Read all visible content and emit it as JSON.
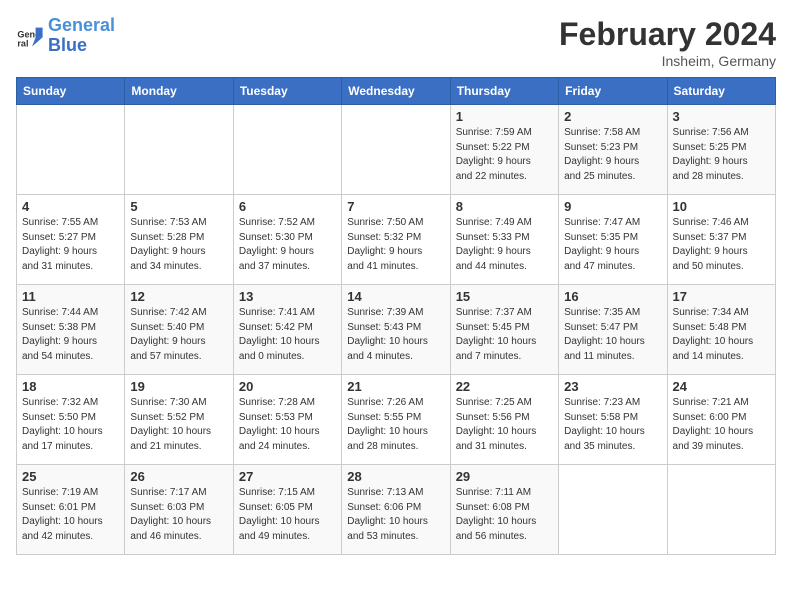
{
  "logo": {
    "line1": "General",
    "line2": "Blue"
  },
  "header": {
    "month": "February 2024",
    "location": "Insheim, Germany"
  },
  "weekdays": [
    "Sunday",
    "Monday",
    "Tuesday",
    "Wednesday",
    "Thursday",
    "Friday",
    "Saturday"
  ],
  "weeks": [
    [
      {
        "day": "",
        "info": ""
      },
      {
        "day": "",
        "info": ""
      },
      {
        "day": "",
        "info": ""
      },
      {
        "day": "",
        "info": ""
      },
      {
        "day": "1",
        "info": "Sunrise: 7:59 AM\nSunset: 5:22 PM\nDaylight: 9 hours\nand 22 minutes."
      },
      {
        "day": "2",
        "info": "Sunrise: 7:58 AM\nSunset: 5:23 PM\nDaylight: 9 hours\nand 25 minutes."
      },
      {
        "day": "3",
        "info": "Sunrise: 7:56 AM\nSunset: 5:25 PM\nDaylight: 9 hours\nand 28 minutes."
      }
    ],
    [
      {
        "day": "4",
        "info": "Sunrise: 7:55 AM\nSunset: 5:27 PM\nDaylight: 9 hours\nand 31 minutes."
      },
      {
        "day": "5",
        "info": "Sunrise: 7:53 AM\nSunset: 5:28 PM\nDaylight: 9 hours\nand 34 minutes."
      },
      {
        "day": "6",
        "info": "Sunrise: 7:52 AM\nSunset: 5:30 PM\nDaylight: 9 hours\nand 37 minutes."
      },
      {
        "day": "7",
        "info": "Sunrise: 7:50 AM\nSunset: 5:32 PM\nDaylight: 9 hours\nand 41 minutes."
      },
      {
        "day": "8",
        "info": "Sunrise: 7:49 AM\nSunset: 5:33 PM\nDaylight: 9 hours\nand 44 minutes."
      },
      {
        "day": "9",
        "info": "Sunrise: 7:47 AM\nSunset: 5:35 PM\nDaylight: 9 hours\nand 47 minutes."
      },
      {
        "day": "10",
        "info": "Sunrise: 7:46 AM\nSunset: 5:37 PM\nDaylight: 9 hours\nand 50 minutes."
      }
    ],
    [
      {
        "day": "11",
        "info": "Sunrise: 7:44 AM\nSunset: 5:38 PM\nDaylight: 9 hours\nand 54 minutes."
      },
      {
        "day": "12",
        "info": "Sunrise: 7:42 AM\nSunset: 5:40 PM\nDaylight: 9 hours\nand 57 minutes."
      },
      {
        "day": "13",
        "info": "Sunrise: 7:41 AM\nSunset: 5:42 PM\nDaylight: 10 hours\nand 0 minutes."
      },
      {
        "day": "14",
        "info": "Sunrise: 7:39 AM\nSunset: 5:43 PM\nDaylight: 10 hours\nand 4 minutes."
      },
      {
        "day": "15",
        "info": "Sunrise: 7:37 AM\nSunset: 5:45 PM\nDaylight: 10 hours\nand 7 minutes."
      },
      {
        "day": "16",
        "info": "Sunrise: 7:35 AM\nSunset: 5:47 PM\nDaylight: 10 hours\nand 11 minutes."
      },
      {
        "day": "17",
        "info": "Sunrise: 7:34 AM\nSunset: 5:48 PM\nDaylight: 10 hours\nand 14 minutes."
      }
    ],
    [
      {
        "day": "18",
        "info": "Sunrise: 7:32 AM\nSunset: 5:50 PM\nDaylight: 10 hours\nand 17 minutes."
      },
      {
        "day": "19",
        "info": "Sunrise: 7:30 AM\nSunset: 5:52 PM\nDaylight: 10 hours\nand 21 minutes."
      },
      {
        "day": "20",
        "info": "Sunrise: 7:28 AM\nSunset: 5:53 PM\nDaylight: 10 hours\nand 24 minutes."
      },
      {
        "day": "21",
        "info": "Sunrise: 7:26 AM\nSunset: 5:55 PM\nDaylight: 10 hours\nand 28 minutes."
      },
      {
        "day": "22",
        "info": "Sunrise: 7:25 AM\nSunset: 5:56 PM\nDaylight: 10 hours\nand 31 minutes."
      },
      {
        "day": "23",
        "info": "Sunrise: 7:23 AM\nSunset: 5:58 PM\nDaylight: 10 hours\nand 35 minutes."
      },
      {
        "day": "24",
        "info": "Sunrise: 7:21 AM\nSunset: 6:00 PM\nDaylight: 10 hours\nand 39 minutes."
      }
    ],
    [
      {
        "day": "25",
        "info": "Sunrise: 7:19 AM\nSunset: 6:01 PM\nDaylight: 10 hours\nand 42 minutes."
      },
      {
        "day": "26",
        "info": "Sunrise: 7:17 AM\nSunset: 6:03 PM\nDaylight: 10 hours\nand 46 minutes."
      },
      {
        "day": "27",
        "info": "Sunrise: 7:15 AM\nSunset: 6:05 PM\nDaylight: 10 hours\nand 49 minutes."
      },
      {
        "day": "28",
        "info": "Sunrise: 7:13 AM\nSunset: 6:06 PM\nDaylight: 10 hours\nand 53 minutes."
      },
      {
        "day": "29",
        "info": "Sunrise: 7:11 AM\nSunset: 6:08 PM\nDaylight: 10 hours\nand 56 minutes."
      },
      {
        "day": "",
        "info": ""
      },
      {
        "day": "",
        "info": ""
      }
    ]
  ]
}
